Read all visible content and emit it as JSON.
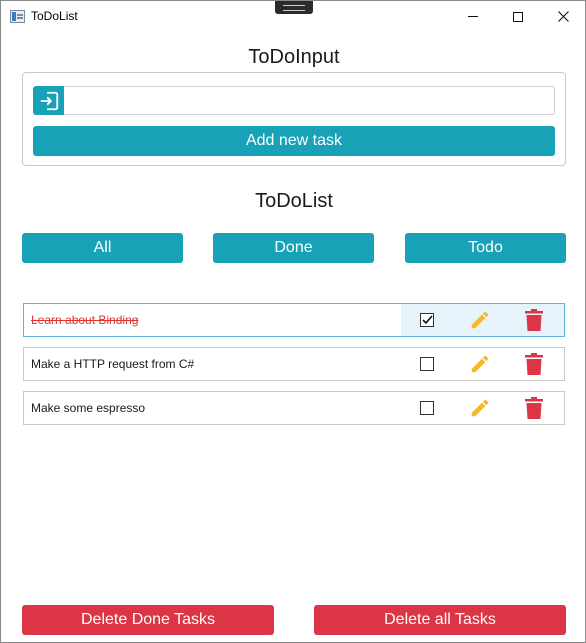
{
  "window": {
    "title": "ToDoList",
    "icons": {
      "app": "app-window-icon",
      "minimize": "minimize-icon",
      "maximize": "maximize-icon",
      "close": "close-icon"
    }
  },
  "input_section": {
    "title": "ToDoInput",
    "input_value": "",
    "input_placeholder": "",
    "input_icon": "login-enter-icon",
    "add_label": "Add new task"
  },
  "list_section": {
    "title": "ToDoList",
    "filters": [
      {
        "label": "All"
      },
      {
        "label": "Done"
      },
      {
        "label": "Todo"
      }
    ]
  },
  "tasks": [
    {
      "text": "Learn about Binding",
      "done": true,
      "selected": true,
      "edit_icon": "pencil-icon",
      "delete_icon": "trash-icon"
    },
    {
      "text": "Make a HTTP request from C#",
      "done": false,
      "selected": false,
      "edit_icon": "pencil-icon",
      "delete_icon": "trash-icon"
    },
    {
      "text": "Make some espresso",
      "done": false,
      "selected": false,
      "edit_icon": "pencil-icon",
      "delete_icon": "trash-icon"
    }
  ],
  "footer": {
    "delete_done_label": "Delete Done Tasks",
    "delete_all_label": "Delete all Tasks"
  },
  "colors": {
    "accent": "#17a2b8",
    "danger": "#dc3545",
    "edit": "#f5b82e",
    "done_text": "#e03434",
    "selected_bg": "#e6f3fb",
    "selected_border": "#5ab6dc"
  }
}
